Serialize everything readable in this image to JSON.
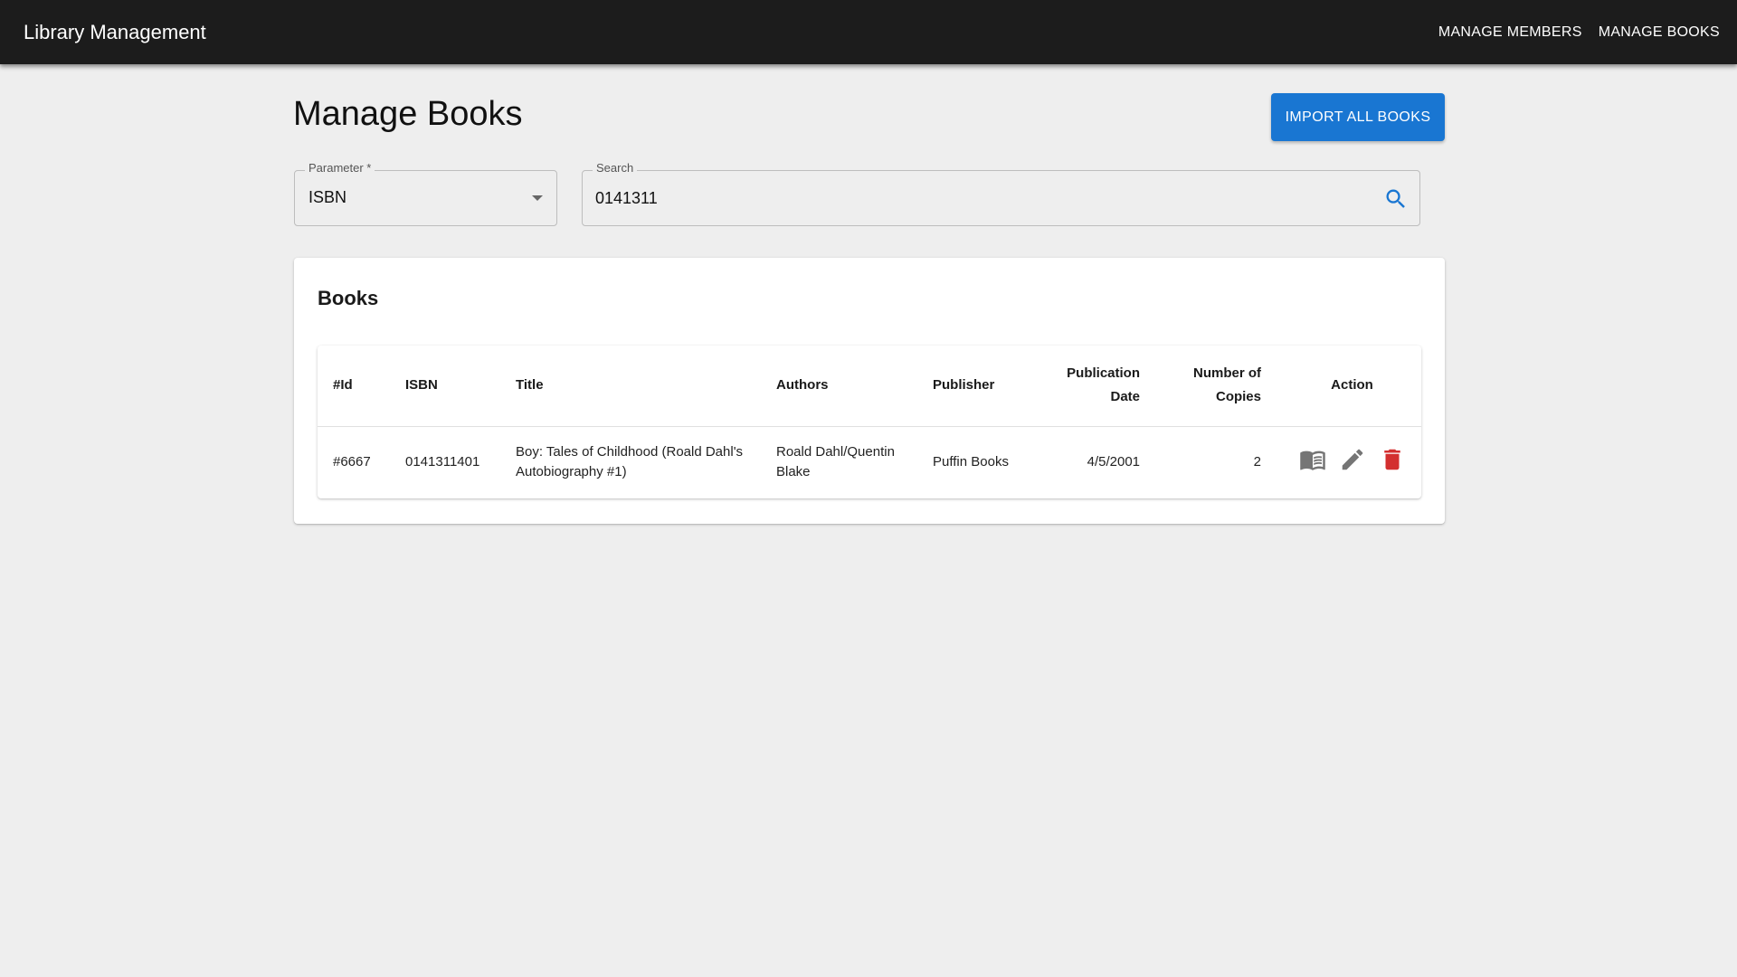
{
  "app": {
    "title": "Library Management"
  },
  "nav": {
    "members": "MANAGE MEMBERS",
    "books": "MANAGE BOOKS"
  },
  "page": {
    "title": "Manage Books",
    "import_label": "IMPORT ALL BOOKS"
  },
  "filters": {
    "parameter_label": "Parameter *",
    "parameter_value": "ISBN",
    "search_label": "Search",
    "search_value": "0141311"
  },
  "books": {
    "title": "Books",
    "columns": [
      "#Id",
      "ISBN",
      "Title",
      "Authors",
      "Publisher",
      "Publication Date",
      "Number of Copies",
      "Action"
    ],
    "rows": [
      {
        "id": "#6667",
        "isbn": "0141311401",
        "title": "Boy: Tales of Childhood (Roald Dahl's Autobiography #1)",
        "authors": "Roald Dahl/Quentin Blake",
        "publisher": "Puffin Books",
        "publication_date": "4/5/2001",
        "copies": "2"
      }
    ]
  },
  "icons": {
    "view": "menu-book-icon",
    "edit": "edit-icon",
    "delete": "delete-icon",
    "search": "search-icon",
    "dropdown": "arrow-drop-down-icon"
  },
  "colors": {
    "appbar": "#1c1c1c",
    "primary": "#1976d2",
    "delete": "#d32f2f",
    "icon": "#757575"
  }
}
